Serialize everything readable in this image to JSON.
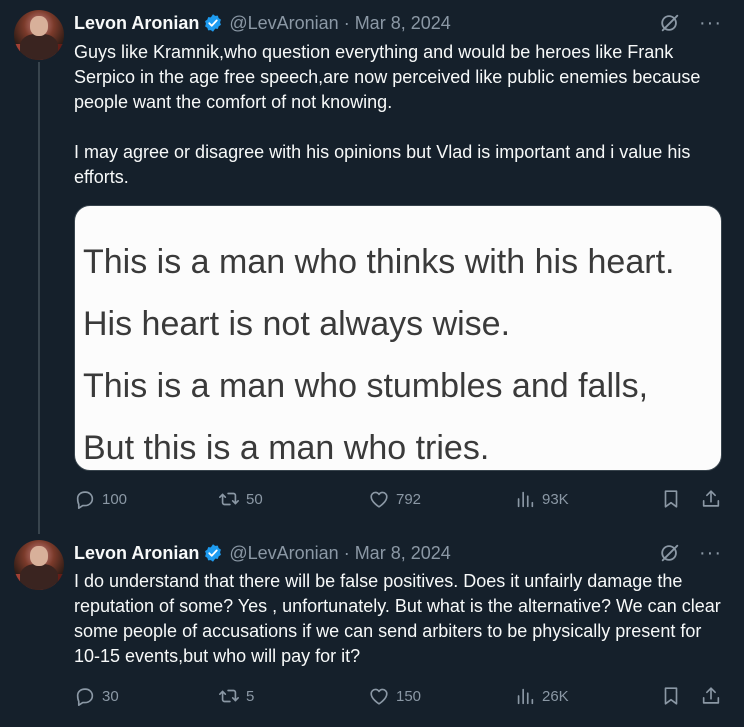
{
  "tweets": [
    {
      "author_name": "Levon Aronian",
      "handle": "@LevAronian",
      "separator": "·",
      "date": "Mar 8, 2024",
      "more": "···",
      "text": "Guys like Kramnik,who question everything and would be heroes like Frank Serpico in the age free speech,are now perceived like public enemies because people want the comfort of not knowing.\n\nI may agree or disagree with his opinions but Vlad is important and i value his efforts.",
      "image_text": [
        "This is a man who thinks with his heart.",
        "His heart is not always wise.",
        "This is a man who stumbles and falls,",
        "But this is a man who tries."
      ],
      "replies": "100",
      "reposts": "50",
      "likes": "792",
      "views": "93K"
    },
    {
      "author_name": "Levon Aronian",
      "handle": "@LevAronian",
      "separator": "·",
      "date": "Mar 8, 2024",
      "more": "···",
      "text": "I do understand that there will be false positives. Does it unfairly damage the reputation of some? Yes , unfortunately. But what is the alternative? We can clear some people of accusations if we can send arbiters to be physically present for 10-15 events,but who will pay for it?",
      "replies": "30",
      "reposts": "5",
      "likes": "150",
      "views": "26K"
    }
  ],
  "colors": {
    "background": "#15202b",
    "text": "#f7f9f9",
    "muted": "#8b98a5",
    "verified": "#1d9bf0",
    "thread_line": "#38444d"
  }
}
